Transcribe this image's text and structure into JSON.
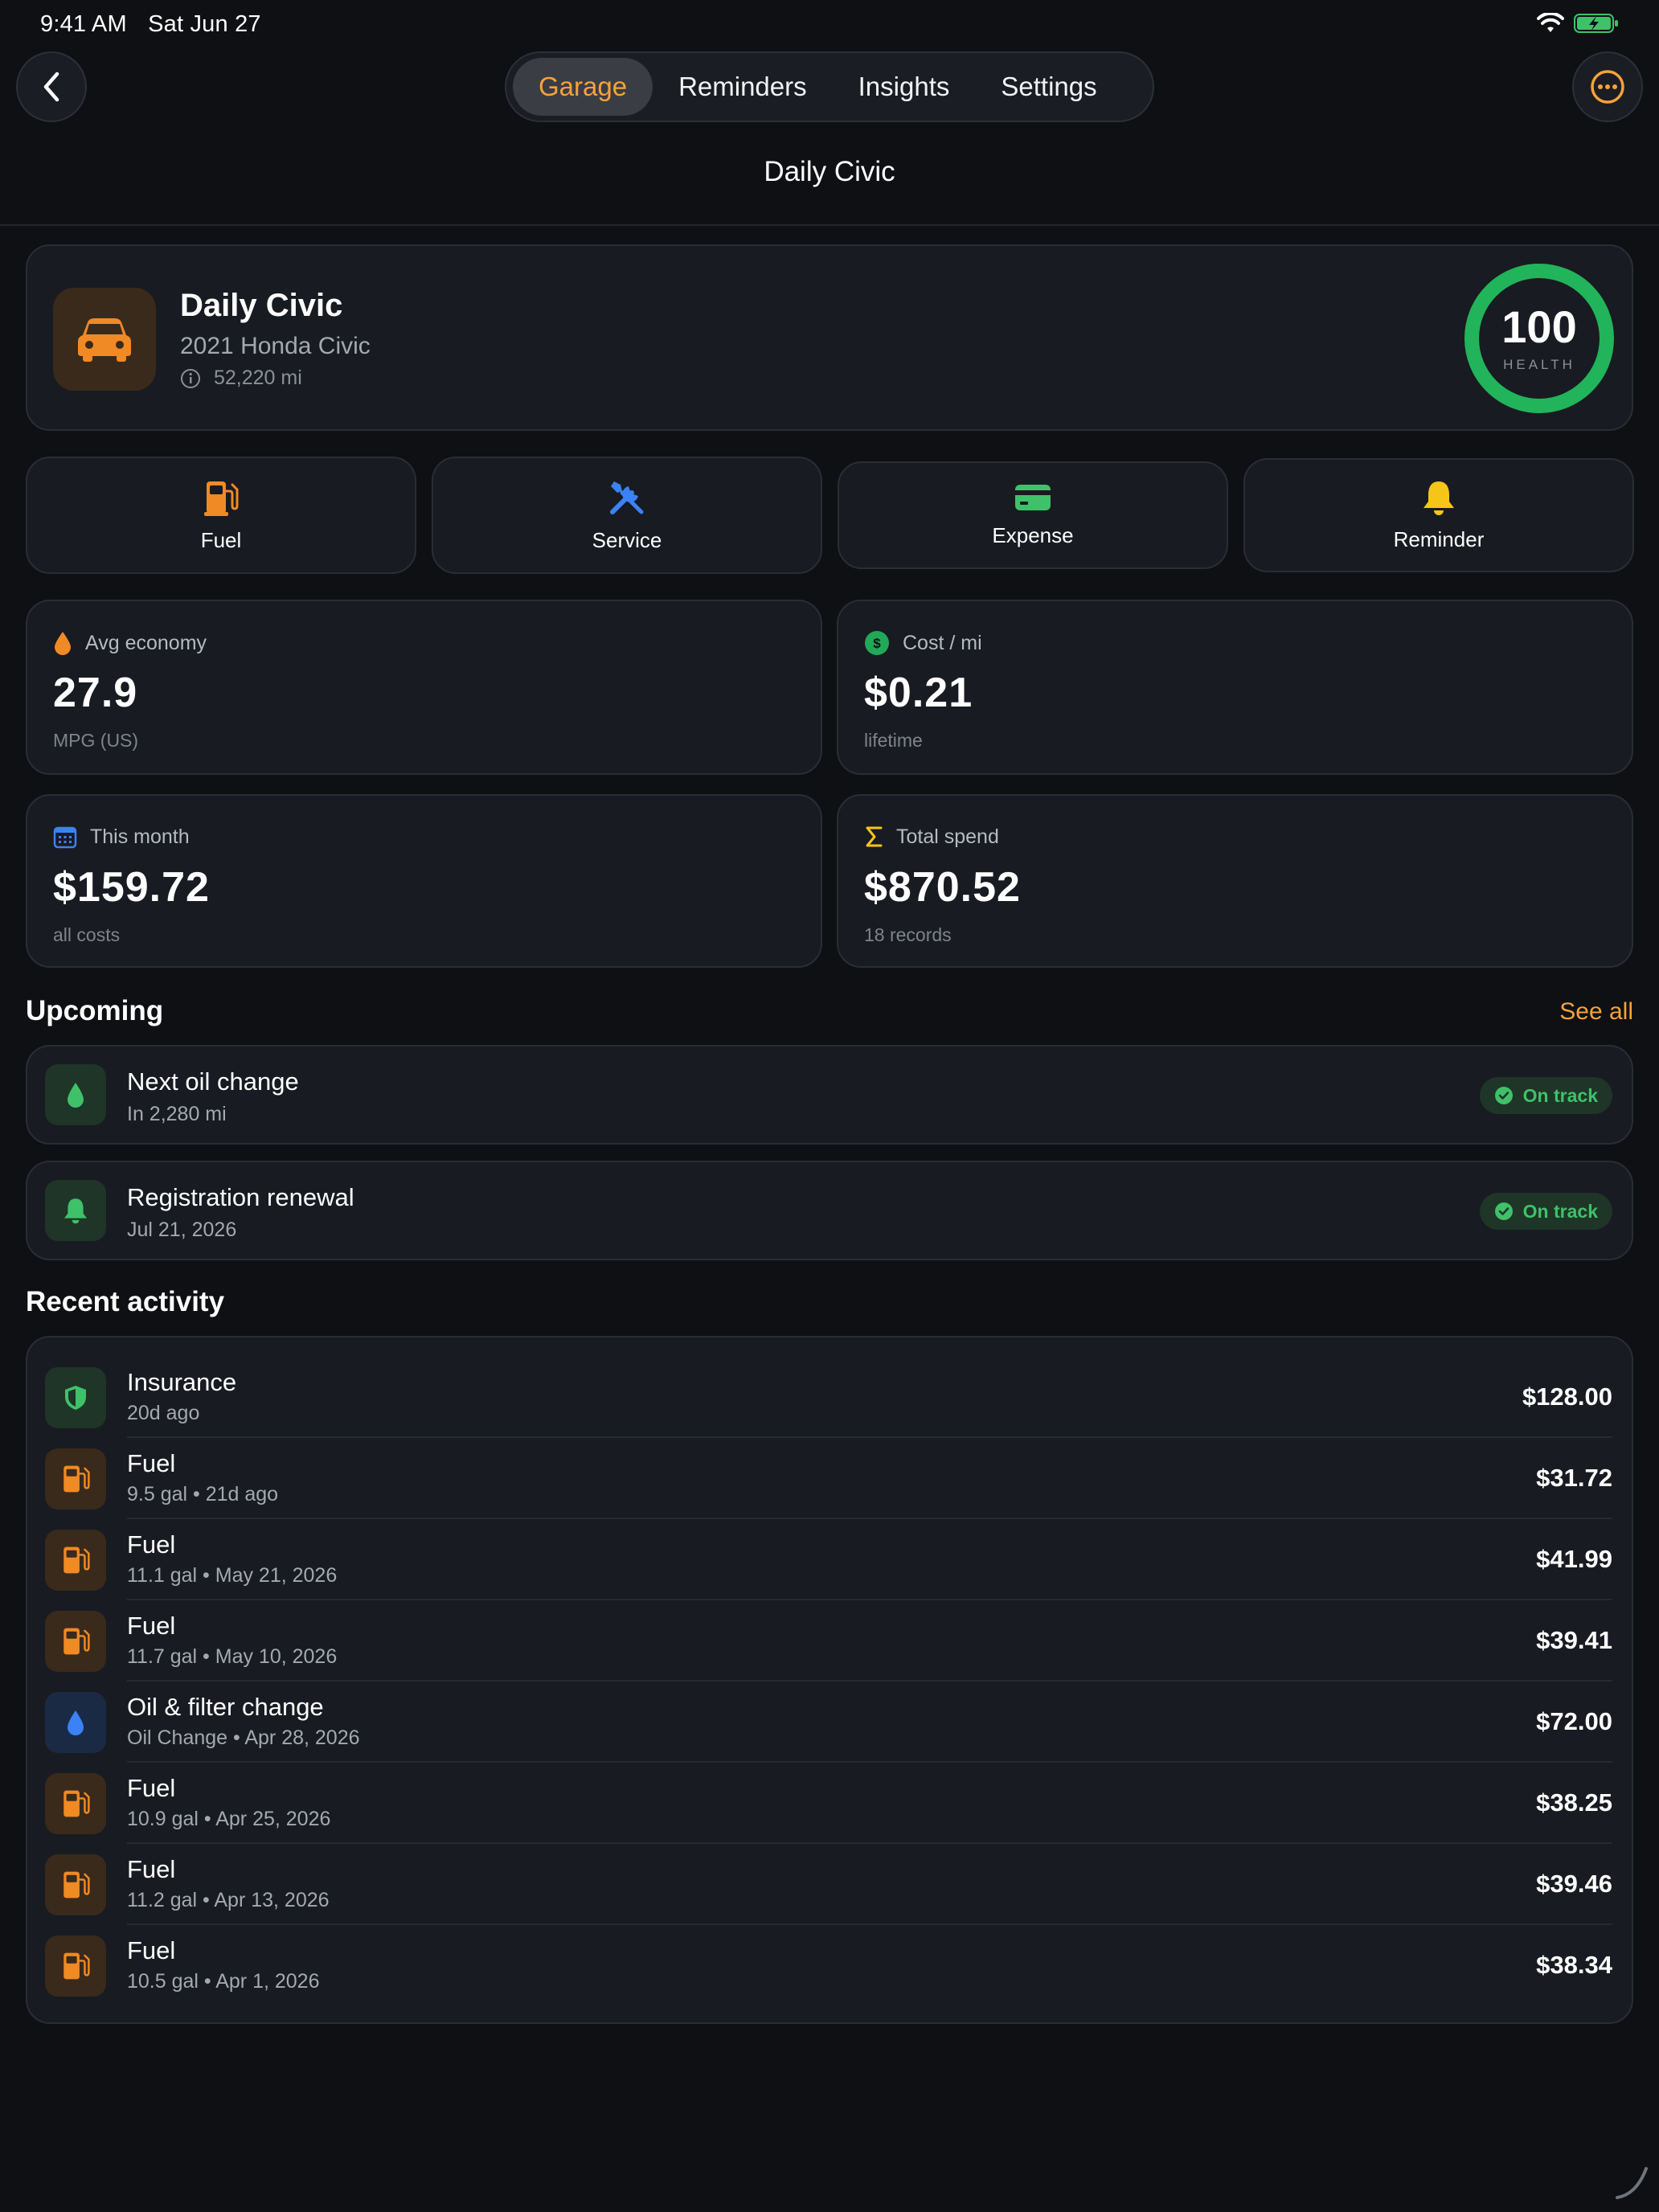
{
  "status_bar": {
    "time": "9:41 AM",
    "date": "Sat Jun 27"
  },
  "nav": {
    "tabs": [
      {
        "label": "Garage",
        "active": true
      },
      {
        "label": "Reminders"
      },
      {
        "label": "Insights"
      },
      {
        "label": "Settings"
      }
    ],
    "title": "Daily Civic"
  },
  "vehicle": {
    "name": "Daily Civic",
    "model": "2021 Honda Civic",
    "mileage": "52,220 mi",
    "health_value": "100",
    "health_label": "HEALTH",
    "health_fraction": 1.0
  },
  "quick_actions": [
    {
      "label": "Fuel",
      "icon": "fuel-pump-icon",
      "color": "#f08a24"
    },
    {
      "label": "Service",
      "icon": "wrench-screwdriver-icon",
      "color": "#3b82f6"
    },
    {
      "label": "Expense",
      "icon": "credit-card-icon",
      "color": "#3fc16a"
    },
    {
      "label": "Reminder",
      "icon": "bell-icon",
      "color": "#f5c518"
    }
  ],
  "stats": {
    "avg_economy": {
      "label": "Avg economy",
      "value": "27.9",
      "sub": "MPG (US)"
    },
    "cost_per_mi": {
      "label": "Cost / mi",
      "value": "$0.21",
      "sub": "lifetime"
    },
    "this_month": {
      "label": "This month",
      "value": "$159.72",
      "sub": "all costs"
    },
    "total_spend": {
      "label": "Total spend",
      "value": "$870.52",
      "sub": "18 records"
    }
  },
  "upcoming": {
    "title": "Upcoming",
    "see_all": "See all",
    "items": [
      {
        "title": "Next oil change",
        "sub": "In 2,280 mi",
        "status": "On track"
      },
      {
        "title": "Registration renewal",
        "sub": "Jul 21, 2026",
        "status": "On track"
      }
    ]
  },
  "recent": {
    "title": "Recent activity",
    "items": [
      {
        "title": "Insurance",
        "sub": "20d ago",
        "amount": "$128.00",
        "icon": "shield-icon"
      },
      {
        "title": "Fuel",
        "sub": "9.5 gal • 21d ago",
        "amount": "$31.72",
        "icon": "fuel-pump-icon"
      },
      {
        "title": "Fuel",
        "sub": "11.1 gal • May 21, 2026",
        "amount": "$41.99",
        "icon": "fuel-pump-icon"
      },
      {
        "title": "Fuel",
        "sub": "11.7 gal • May 10, 2026",
        "amount": "$39.41",
        "icon": "fuel-pump-icon"
      },
      {
        "title": "Oil & filter change",
        "sub": "Oil Change • Apr 28, 2026",
        "amount": "$72.00",
        "icon": "oil-drop-icon"
      },
      {
        "title": "Fuel",
        "sub": "10.9 gal • Apr 25, 2026",
        "amount": "$38.25",
        "icon": "fuel-pump-icon"
      },
      {
        "title": "Fuel",
        "sub": "11.2 gal • Apr 13, 2026",
        "amount": "$39.46",
        "icon": "fuel-pump-icon"
      },
      {
        "title": "Fuel",
        "sub": "10.5 gal • Apr 1, 2026",
        "amount": "$38.34",
        "icon": "fuel-pump-icon"
      }
    ]
  },
  "colors": {
    "accent": "#f5a23a",
    "success": "#3fc16a",
    "background": "#0e1014",
    "card": "#181b21"
  }
}
